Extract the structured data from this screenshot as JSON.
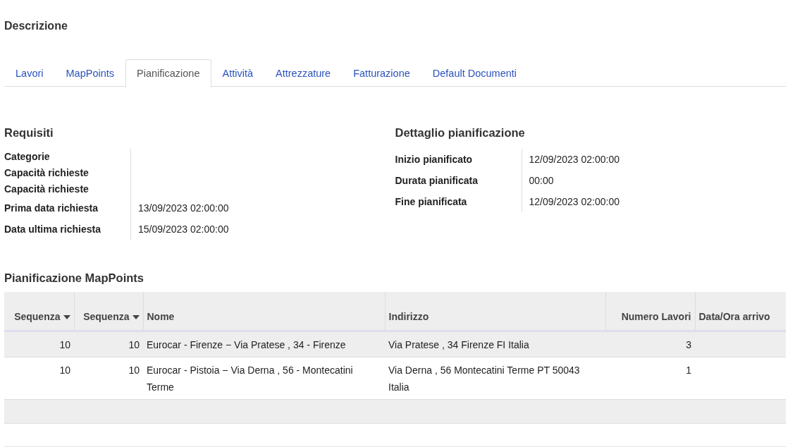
{
  "title": "Descrizione",
  "tabs": [
    {
      "label": "Lavori",
      "selected": false
    },
    {
      "label": "MapPoints",
      "selected": false
    },
    {
      "label": "Pianificazione",
      "selected": true
    },
    {
      "label": "Attività",
      "selected": false
    },
    {
      "label": "Attrezzature",
      "selected": false
    },
    {
      "label": "Fatturazione",
      "selected": false
    },
    {
      "label": "Default Documenti",
      "selected": false
    }
  ],
  "sections": [
    {
      "title": "Requisiti",
      "fields": [
        {
          "label": "Categorie"
        },
        {
          "label": "Capacità richieste"
        },
        {
          "label": "Capacità richieste"
        },
        {
          "label": "Prima data richiesta",
          "value": "13/09/2023 02:00:00"
        },
        {
          "label": "Data ultima richiesta",
          "value": "15/09/2023 02:00:00"
        }
      ]
    },
    {
      "title": "Dettaglio pianificazione",
      "fields": [
        {
          "label": "Inizio pianificato",
          "value": "12/09/2023 02:00:00"
        },
        {
          "label": "Durata pianificata",
          "value": "00:00"
        },
        {
          "label": "Fine pianificata",
          "value": "12/09/2023 02:00:00"
        }
      ]
    }
  ],
  "table": {
    "title": "Pianificazione MapPoints",
    "columns": [
      {
        "label": "Sequenza",
        "sorted": true,
        "kind": "numeric"
      },
      {
        "label": "Sequenza",
        "sorted": true,
        "kind": "numeric"
      },
      {
        "label": "Nome",
        "sorted": false,
        "kind": "text"
      },
      {
        "label": "Indirizzo",
        "sorted": false,
        "kind": "text"
      },
      {
        "label": "Numero Lavori",
        "sorted": false,
        "kind": "numeric"
      },
      {
        "label": "Data/Ora arrivo",
        "sorted": false,
        "kind": "text"
      }
    ],
    "rows": [
      [
        "10",
        "10",
        "Eurocar - Firenze − Via Pratese , 34 - Firenze",
        "Via Pratese , 34 Firenze FI Italia",
        "3",
        ""
      ],
      [
        "10",
        "10",
        "Eurocar - Pistoia − Via Derna , 56 - Montecatini Terme",
        "Via Derna , 56 Montecatini Terme PT 50043 Italia",
        "1",
        ""
      ]
    ]
  }
}
